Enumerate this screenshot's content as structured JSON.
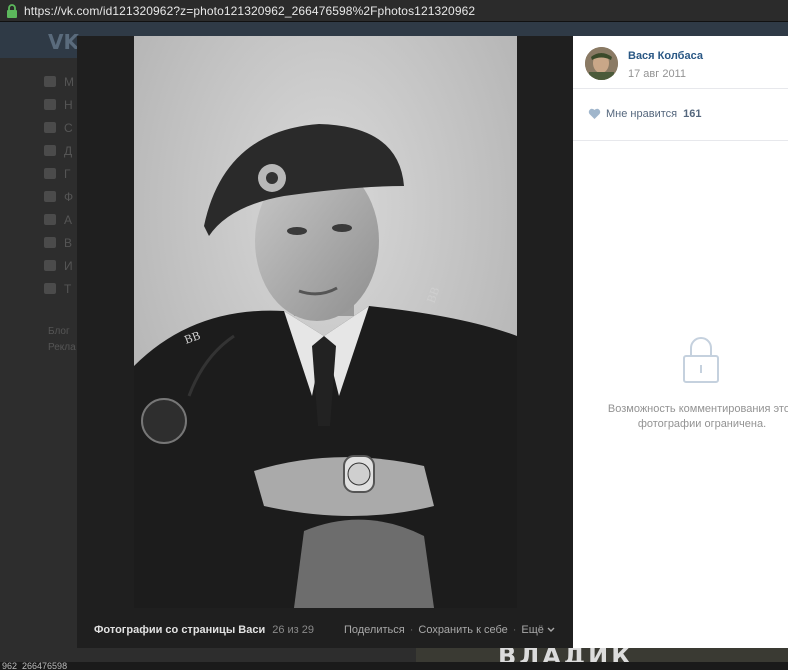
{
  "browser": {
    "url": "https://vk.com/id121320962?z=photo121320962_266476598%2Fphotos121320962"
  },
  "background": {
    "logo": "VK",
    "menu_letters": [
      "М",
      "Н",
      "С",
      "Д",
      "Г",
      "Ф",
      "А",
      "В",
      "И",
      "Т"
    ],
    "footer_lines": [
      "Блог",
      "Рекла"
    ],
    "status_text": "962_266476598",
    "fragment_text": "ВЛАДИК"
  },
  "viewer": {
    "album_title": "Фотографии со страницы Васи",
    "counter": "26 из 29",
    "actions": {
      "share": "Поделиться",
      "save": "Сохранить к себе",
      "more": "Ещё"
    },
    "icons": {
      "lock": "lock-icon",
      "more_chevron": "chevron-down-icon"
    }
  },
  "sidebar": {
    "author_name": "Вася Колбаса",
    "date": "17 авг 2011",
    "like_label": "Мне нравится",
    "like_count": "161",
    "comments_disabled_text": "Возможность комментирования этой\nфотографии ограничена.",
    "icons": {
      "heart": "heart-icon",
      "lock": "lock-icon"
    }
  },
  "colors": {
    "link_blue": "#2a5885",
    "like_grey": "#55677d",
    "heart_blue": "#a0b6cc",
    "muted": "#939393"
  }
}
